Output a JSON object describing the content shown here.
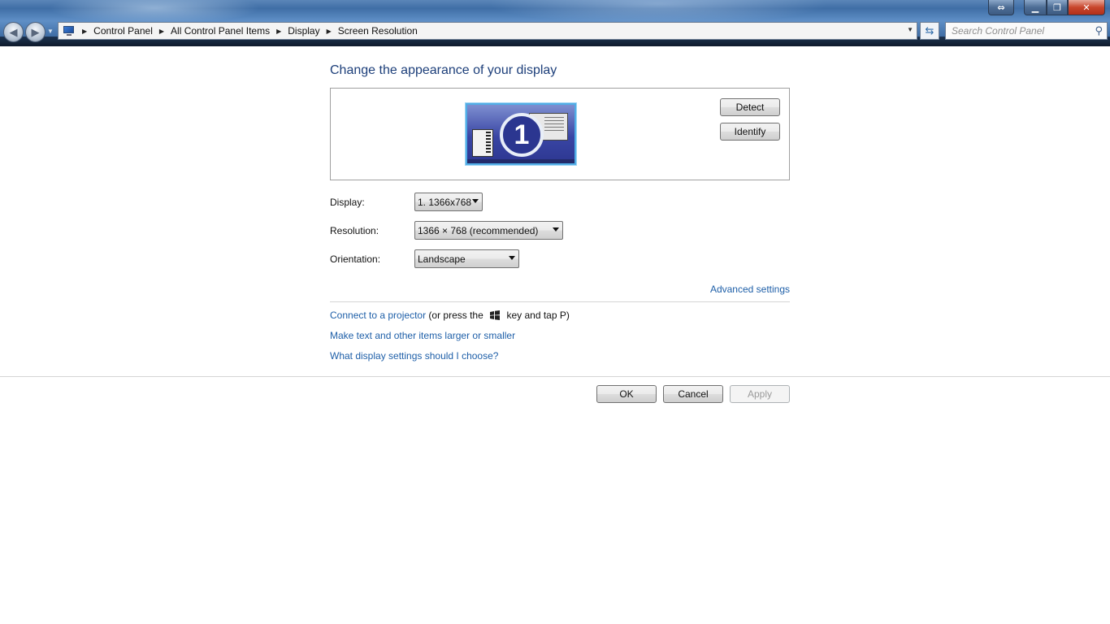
{
  "window": {
    "snap_icon": "resize-arrows-icon",
    "minimize_icon": "minimize-icon",
    "maximize_icon": "restore-icon",
    "close_icon": "close-icon"
  },
  "nav": {
    "back_icon": "back-arrow-icon",
    "forward_icon": "forward-arrow-icon"
  },
  "address": {
    "breadcrumbs": [
      "Control Panel",
      "All Control Panel Items",
      "Display",
      "Screen Resolution"
    ]
  },
  "search": {
    "placeholder": "Search Control Panel"
  },
  "main": {
    "title": "Change the appearance of your display",
    "monitor_number": "1",
    "detect_label": "Detect",
    "identify_label": "Identify",
    "display_label": "Display:",
    "display_value": "1. 1366x768",
    "resolution_label": "Resolution:",
    "resolution_value": "1366 × 768 (recommended)",
    "orientation_label": "Orientation:",
    "orientation_value": "Landscape",
    "advanced_link": "Advanced settings",
    "projector_link": "Connect to a projector",
    "projector_text_before": "(or press the",
    "projector_text_after": "key and tap P)",
    "text_size_link": "Make text and other items larger or smaller",
    "help_link": "What display settings should I choose?"
  },
  "footer": {
    "ok_label": "OK",
    "cancel_label": "Cancel",
    "apply_label": "Apply"
  },
  "colors": {
    "link": "#1e5fa8",
    "title": "#1d3f7a"
  }
}
